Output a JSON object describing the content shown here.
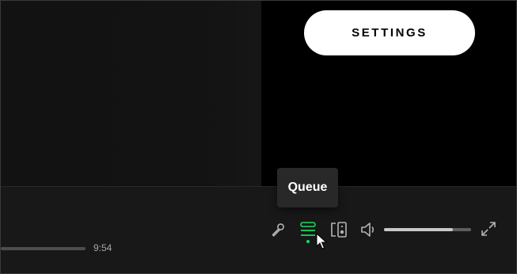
{
  "header": {
    "settings_label": "SETTINGS"
  },
  "player": {
    "elapsed_time": "9:54",
    "tooltip_text": "Queue",
    "volume_level": 0.79,
    "controls": {
      "lyrics": "microphone-icon",
      "queue": "queue-icon",
      "connect": "connect-device-icon",
      "volume": "volume-icon",
      "fullscreen": "fullscreen-icon"
    }
  },
  "colors": {
    "accent": "#1ed760",
    "player_bg": "#181818",
    "tooltip_bg": "#282828"
  }
}
